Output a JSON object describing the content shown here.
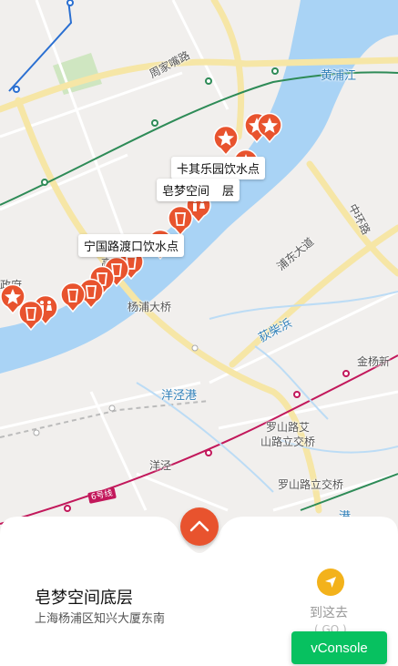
{
  "map": {
    "place_labels": {
      "zhoujiazui_road": "周家嘴路",
      "huangpu_river": "黄浦江",
      "zhonghuan_road": "中环路",
      "pudong_avenue": "浦东大道",
      "yangpu_bridge": "杨浦大桥",
      "dichai_creek": "荻柴浜",
      "jinyang_new": "金杨新",
      "yangjing_port": "洋泾港",
      "luoshan_ai": "罗山路艾",
      "luoshan_interchange_1": "山路立交桥",
      "yangjing": "洋泾",
      "luoshan_interchange_2": "罗山路立交桥",
      "zhengfu": "政府",
      "gao": "高",
      "gang": "港"
    },
    "metro_badge": "6号线",
    "callouts": {
      "kaqi_park": "卡其乐园饮水点",
      "zaomeng": "皂梦空间",
      "zaomeng_suffix": "层",
      "ningguo_ferry": "宁国路渡口饮水点"
    },
    "colors": {
      "land": "#f1efed",
      "water": "#a9d3f5",
      "arterial": "#f6e6a6",
      "metro_green": "#2e8b57",
      "metro_magenta": "#c2185b",
      "pin": "#e8532e"
    }
  },
  "sheet": {
    "title": "皂梦空间底层",
    "address": "上海杨浦区知兴大厦东南",
    "go_label": "到这去",
    "go_sub": "( GO )"
  },
  "vconsole": {
    "label": "vConsole"
  }
}
